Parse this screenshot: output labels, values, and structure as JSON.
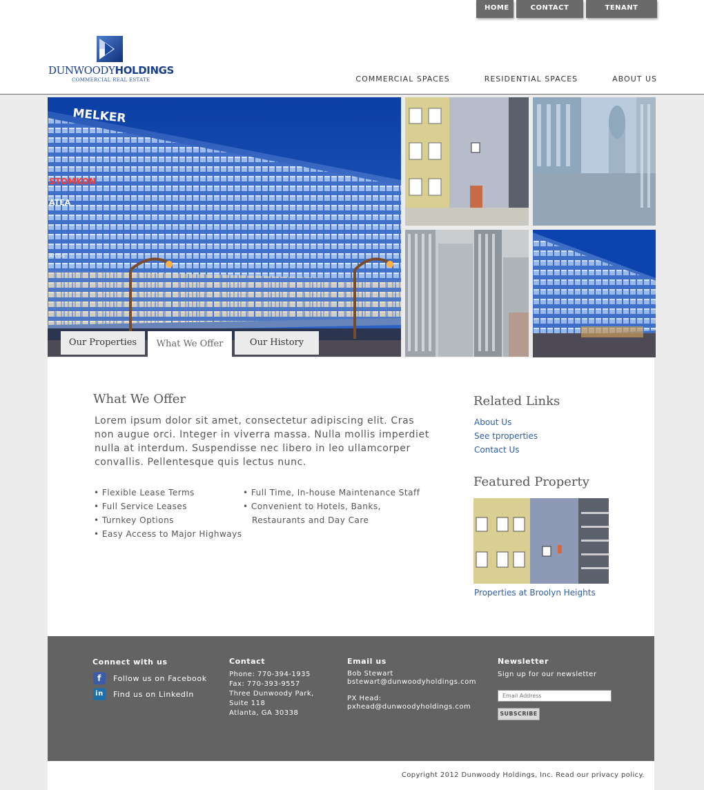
{
  "top_nav": [
    "HOME",
    "CONTACT  US",
    "TENANT PORTAL"
  ],
  "logo": {
    "name_light": "DUNWOODY",
    "name_bold": "HOLDINGS",
    "tagline": "COMMERCIAL REAL ESTATE"
  },
  "main_nav": [
    "COMMERCIAL SPACES",
    "RESIDENTIAL SPACES",
    "ABOUT US"
  ],
  "hero": {
    "tabs": [
      "Our Properties",
      "What We Offer",
      "Our History"
    ],
    "active_tab": "What We Offer",
    "signs": [
      "MELKER",
      "STOMKON",
      "ATEA",
      "Arctis"
    ]
  },
  "content": {
    "title": "What We Offer",
    "intro": "Lorem ipsum dolor sit amet, consectetur adipiscing elit. Cras non augue orci. Integer in viverra massa. Nulla mollis imperdiet nulla at interdum. Suspendisse nec libero in leo ullamcorper convallis. Pellentesque quis lectus nunc.",
    "features_left": [
      "• Flexible Lease Terms",
      "• Full Service Leases",
      "• Turnkey Options",
      "• Easy Access to Major Highways"
    ],
    "features_right": [
      "• Full Time, In-house Maintenance Staff",
      "• Convenient to Hotels, Banks,",
      "   Restaurants and Day Care"
    ]
  },
  "sidebar": {
    "related_title": "Related Links",
    "links": [
      "About Us",
      "See tproperties",
      "Contact Us"
    ],
    "featured_title": "Featured Property",
    "featured_caption": "Properties at Broolyn Heights"
  },
  "footer": {
    "connect": {
      "title": "Connect with us",
      "facebook": "Follow us on Facebook",
      "linkedin": "Find us on LinkedIn"
    },
    "contact": {
      "title": "Contact",
      "lines": [
        "Phone: 770-394-1935",
        "Fax: 770-393-9557",
        "Three Dunwoody Park,",
        "Suite 118",
        "Atlanta, GA 30338"
      ]
    },
    "email": {
      "title": "Email us",
      "lines1": [
        "Bob Stewart",
        "bstewart@dunwoodyholdings.com"
      ],
      "lines2": [
        "PX Head:",
        "pxhead@dunwoodyholdings.com"
      ]
    },
    "newsletter": {
      "title": "Newsletter",
      "text": "Sign up for our newsletter",
      "input_placeholder": "Email Address",
      "button": "SUBSCRIBE"
    }
  },
  "copyright": "Copyright 2012 Dunwoody Holdings, Inc. Read our privacy policy.",
  "colors": {
    "link": "#2f5fa5",
    "footer_bg": "#636363",
    "brand_blue": "#1a3f8a",
    "nav_tab": "#6a6a6a"
  }
}
